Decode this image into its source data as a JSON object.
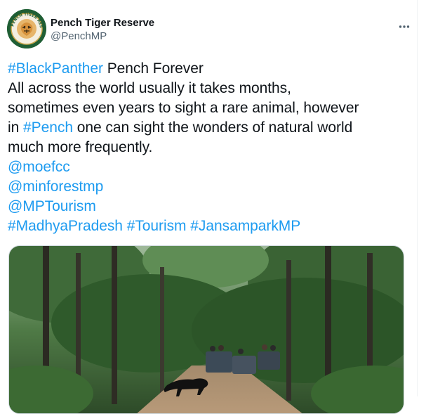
{
  "author": {
    "display_name": "Pench Tiger Reserve",
    "handle": "@PenchMP",
    "avatar_text": "PENCH TIGER RESERVE"
  },
  "tweet": {
    "line1_tag": "#BlackPanther",
    "line1_text": " Pench Forever",
    "line2": "All across the world usually it takes months,",
    "line3": "sometimes even years to sight a rare animal, however",
    "line4_pre": "in ",
    "line4_tag": "#Pench",
    "line4_post": " one can sight the wonders of natural world",
    "line5": "much more frequently.",
    "mention1": "@moefcc",
    "mention2": "@minforestmp",
    "mention3": "@MPTourism",
    "hashtags": [
      "#MadhyaPradesh",
      "#Tourism",
      "#JansamparkMP"
    ]
  },
  "colors": {
    "link": "#1d9bf0",
    "text": "#0f1419",
    "secondary": "#536471",
    "avatar_bg": "#1f5e34"
  },
  "icons": {
    "more": "more-horizontal-icon"
  },
  "media": {
    "type": "image",
    "subject": "black panther crossing forest road with safari jeeps"
  }
}
